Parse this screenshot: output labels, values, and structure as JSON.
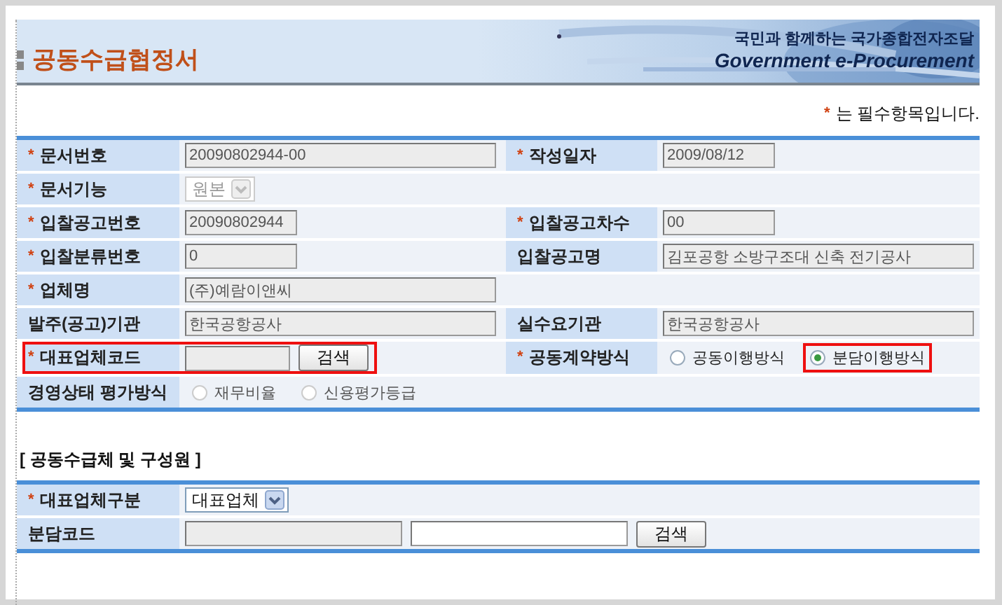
{
  "header": {
    "title": "공동수급협정서",
    "banner_lines": [
      "국민과 함께하는 국가종합전자조달",
      "Government e-Procurement"
    ]
  },
  "required_note": {
    "mark": "*",
    "text": "는 필수항목입니다."
  },
  "form": {
    "rows": [
      {
        "cells": [
          {
            "label": "문서번호",
            "required": true,
            "field": {
              "kind": "wide",
              "value": "20090802944-00",
              "disabled": true
            }
          },
          {
            "label": "작성일자",
            "required": true,
            "field": {
              "kind": "text",
              "value": "2009/08/12",
              "disabled": true
            }
          }
        ]
      },
      {
        "cells": [
          {
            "label": "문서기능",
            "required": true,
            "field": {
              "kind": "select",
              "value": "원본",
              "disabled": true
            }
          }
        ]
      },
      {
        "cells": [
          {
            "label": "입찰공고번호",
            "required": true,
            "field": {
              "kind": "text",
              "value": "20090802944",
              "disabled": true
            }
          },
          {
            "label": "입찰공고차수",
            "required": true,
            "field": {
              "kind": "text",
              "value": "00",
              "disabled": true
            }
          }
        ]
      },
      {
        "cells": [
          {
            "label": "입찰분류번호",
            "required": true,
            "field": {
              "kind": "text",
              "value": "0",
              "disabled": true
            }
          },
          {
            "label": "입찰공고명",
            "required": false,
            "field": {
              "kind": "wide",
              "value": "김포공항 소방구조대 신축 전기공사",
              "disabled": true
            }
          }
        ]
      },
      {
        "cells": [
          {
            "label": "업체명",
            "required": true,
            "field": {
              "kind": "wide",
              "value": "(주)예람이앤씨",
              "disabled": true
            }
          }
        ]
      },
      {
        "cells": [
          {
            "label": "발주(공고)기관",
            "required": false,
            "field": {
              "kind": "wide",
              "value": "한국공항공사",
              "disabled": true
            }
          },
          {
            "label": "실수요기관",
            "required": false,
            "field": {
              "kind": "wide",
              "value": "한국공항공사",
              "disabled": true
            }
          }
        ]
      },
      {
        "cells": [
          {
            "label": "대표업체코드",
            "required": true,
            "highlighted": true,
            "field": {
              "kind": "search",
              "value_disabled": true,
              "button": "검색"
            }
          },
          {
            "label": "공동계약방식",
            "required": true,
            "field": {
              "kind": "radio",
              "disabled": false,
              "options": [
                {
                  "label": "공동이행방식",
                  "selected": false,
                  "highlighted": false
                },
                {
                  "label": "분담이행방식",
                  "selected": true,
                  "highlighted": true
                }
              ]
            }
          }
        ]
      },
      {
        "cells": [
          {
            "label": "경영상태 평가방식",
            "required": false,
            "field": {
              "kind": "radio",
              "disabled": true,
              "options": [
                {
                  "label": "재무비율",
                  "selected": false,
                  "highlighted": false
                },
                {
                  "label": "신용평가등급",
                  "selected": false,
                  "highlighted": false
                }
              ]
            }
          }
        ]
      }
    ]
  },
  "members": {
    "title": "[ 공동수급체 및 구성원 ]",
    "rows": [
      {
        "cells": [
          {
            "label": "대표업체구분",
            "required": true,
            "field": {
              "kind": "select",
              "value": "대표업체",
              "disabled": false
            }
          }
        ]
      },
      {
        "cells": [
          {
            "label": "분담코드",
            "required": false,
            "field": {
              "kind": "search2",
              "button": "검색"
            }
          }
        ]
      }
    ]
  }
}
